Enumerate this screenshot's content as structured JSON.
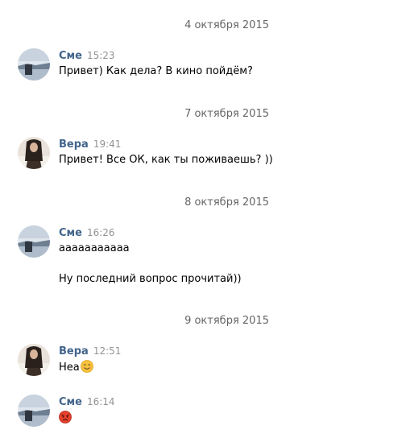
{
  "messages_log": {
    "groups": [
      {
        "date": "4 октября 2015",
        "author": "Сме",
        "time": "15:23",
        "lines": [
          "Привет) Как дела? В кино пойдём?"
        ]
      },
      {
        "date": "7 октября 2015",
        "author": "Вера",
        "time": "19:41",
        "lines": [
          "Привет! Все ОК, как ты поживаешь? ))"
        ]
      },
      {
        "date": "8 октября 2015",
        "author": "Сме",
        "time": "16:26",
        "lines": [
          "ааааааааааа",
          "Ну последний вопрос прочитай))"
        ]
      },
      {
        "date": "9 октября 2015",
        "author": "Вера",
        "time": "12:51",
        "lines": [
          "Неа"
        ],
        "emoji": "smiling-face-icon"
      },
      {
        "author": "Сме",
        "time": "16:14",
        "lines": [
          ""
        ],
        "emoji": "angry-face-icon"
      }
    ]
  },
  "colors": {
    "author": "#42648b",
    "time": "#939393",
    "date": "#656565",
    "text": "#000000"
  }
}
